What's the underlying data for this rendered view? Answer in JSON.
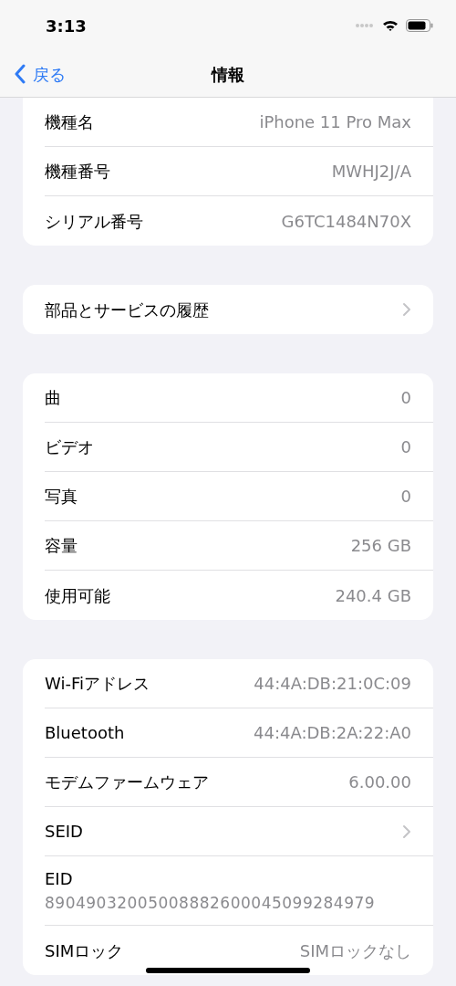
{
  "status_bar": {
    "time": "3:13"
  },
  "nav": {
    "back": "戻る",
    "title": "情報"
  },
  "groups": [
    {
      "rows": [
        {
          "kind": "value",
          "label": "機種名",
          "value": "iPhone 11 Pro Max"
        },
        {
          "kind": "value",
          "label": "機種番号",
          "value": "MWHJ2J/A"
        },
        {
          "kind": "value",
          "label": "シリアル番号",
          "value": "G6TC1484N70X"
        }
      ]
    },
    {
      "rows": [
        {
          "kind": "chevron",
          "label": "部品とサービスの履歴"
        }
      ]
    },
    {
      "rows": [
        {
          "kind": "value",
          "label": "曲",
          "value": "0"
        },
        {
          "kind": "value",
          "label": "ビデオ",
          "value": "0"
        },
        {
          "kind": "value",
          "label": "写真",
          "value": "0"
        },
        {
          "kind": "value",
          "label": "容量",
          "value": "256 GB"
        },
        {
          "kind": "value",
          "label": "使用可能",
          "value": "240.4 GB"
        }
      ]
    },
    {
      "rows": [
        {
          "kind": "value",
          "label": "Wi-Fiアドレス",
          "value": "44:4A:DB:21:0C:09"
        },
        {
          "kind": "value",
          "label": "Bluetooth",
          "value": "44:4A:DB:2A:22:A0"
        },
        {
          "kind": "value",
          "label": "モデムファームウェア",
          "value": "6.00.00"
        },
        {
          "kind": "chevron",
          "label": "SEID"
        },
        {
          "kind": "stacked",
          "label": "EID",
          "value": "89049032005008882600045099284979"
        },
        {
          "kind": "value",
          "label": "SIMロック",
          "value": "SIMロックなし"
        }
      ]
    }
  ]
}
